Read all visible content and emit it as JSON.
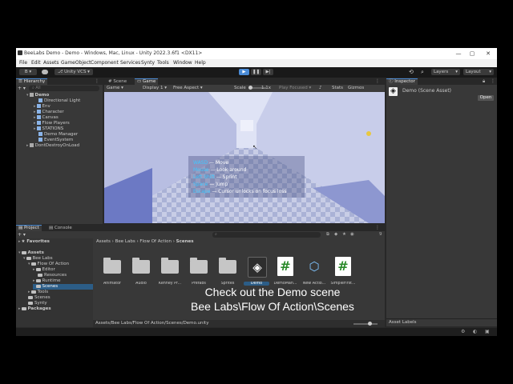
{
  "window": {
    "title": "BeeLabs Demo - Demo - Windows, Mac, Linux - Unity 2022.3.6f1 <DX11>",
    "controls": [
      "—",
      "▢",
      "✕"
    ]
  },
  "menubar": [
    "File",
    "Edit",
    "Assets",
    "GameObject",
    "Component",
    "Services",
    "Synty",
    "Tools",
    "Window",
    "Help"
  ],
  "toolbar": {
    "account": "B",
    "vcs": "Unity VCS",
    "layers": "Layers",
    "layout": "Layout"
  },
  "hierarchy": {
    "tab": "Hierarchy",
    "search_placeholder": "All",
    "items": [
      {
        "label": "Demo"
      },
      {
        "label": "Directional Light"
      },
      {
        "label": "Env"
      },
      {
        "label": "Character"
      },
      {
        "label": "Canvas"
      },
      {
        "label": "Flow Players"
      },
      {
        "label": "STATIONS"
      },
      {
        "label": "Demo Manager"
      },
      {
        "label": "EventSystem"
      },
      {
        "label": "DontDestroyOnLoad"
      }
    ]
  },
  "scene_tabs": {
    "scene": "Scene",
    "game": "Game"
  },
  "game_bar": {
    "mode": "Game",
    "display": "Display 1",
    "aspect": "Free Aspect",
    "scale_label": "Scale",
    "scale_value": "1.1x",
    "play_focused": "Play Focused",
    "stats": "Stats",
    "gizmos": "Gizmos"
  },
  "controls_help": [
    {
      "key": "WASD",
      "desc": " — Move"
    },
    {
      "key": "Mouse",
      "desc": " — Look around"
    },
    {
      "key": "Left Shift",
      "desc": " — Sprint"
    },
    {
      "key": "Space",
      "desc": " — Jump"
    },
    {
      "key": "Escape",
      "desc": " — Cursor unlocks on focus loss"
    }
  ],
  "inspector": {
    "tab": "Inspector",
    "asset_name": "Demo (Scene Asset)",
    "open_button": "Open",
    "asset_labels": "Asset Labels"
  },
  "project": {
    "tab_project": "Project",
    "tab_console": "Console",
    "count": "9",
    "tree": [
      {
        "label": "Favorites"
      },
      {
        "label": "Assets"
      },
      {
        "label": "Bee Labs"
      },
      {
        "label": "Flow Of Action"
      },
      {
        "label": "Editor"
      },
      {
        "label": "Resources"
      },
      {
        "label": "Runtime"
      },
      {
        "label": "Scenes"
      },
      {
        "label": "Tools"
      },
      {
        "label": "Scenes"
      },
      {
        "label": "Synty"
      },
      {
        "label": "Packages"
      }
    ],
    "breadcrumb": [
      "Assets",
      "Bee Labs",
      "Flow Of Action",
      "Scenes"
    ],
    "assets": [
      {
        "label": "Animator"
      },
      {
        "label": "Audio"
      },
      {
        "label": "Kenney Pr..."
      },
      {
        "label": "Prefabs"
      },
      {
        "label": "Sprites"
      },
      {
        "label": "Demo"
      },
      {
        "label": "DemoMan..."
      },
      {
        "label": "New Actio..."
      },
      {
        "label": "SimpleFirst..."
      }
    ],
    "path": "Assets/Bee Labs/Flow Of Action/Scenes/Demo.unity"
  },
  "caption": {
    "line1": "Check out the Demo scene",
    "line2": "Bee Labs\\Flow Of Action\\Scenes"
  }
}
